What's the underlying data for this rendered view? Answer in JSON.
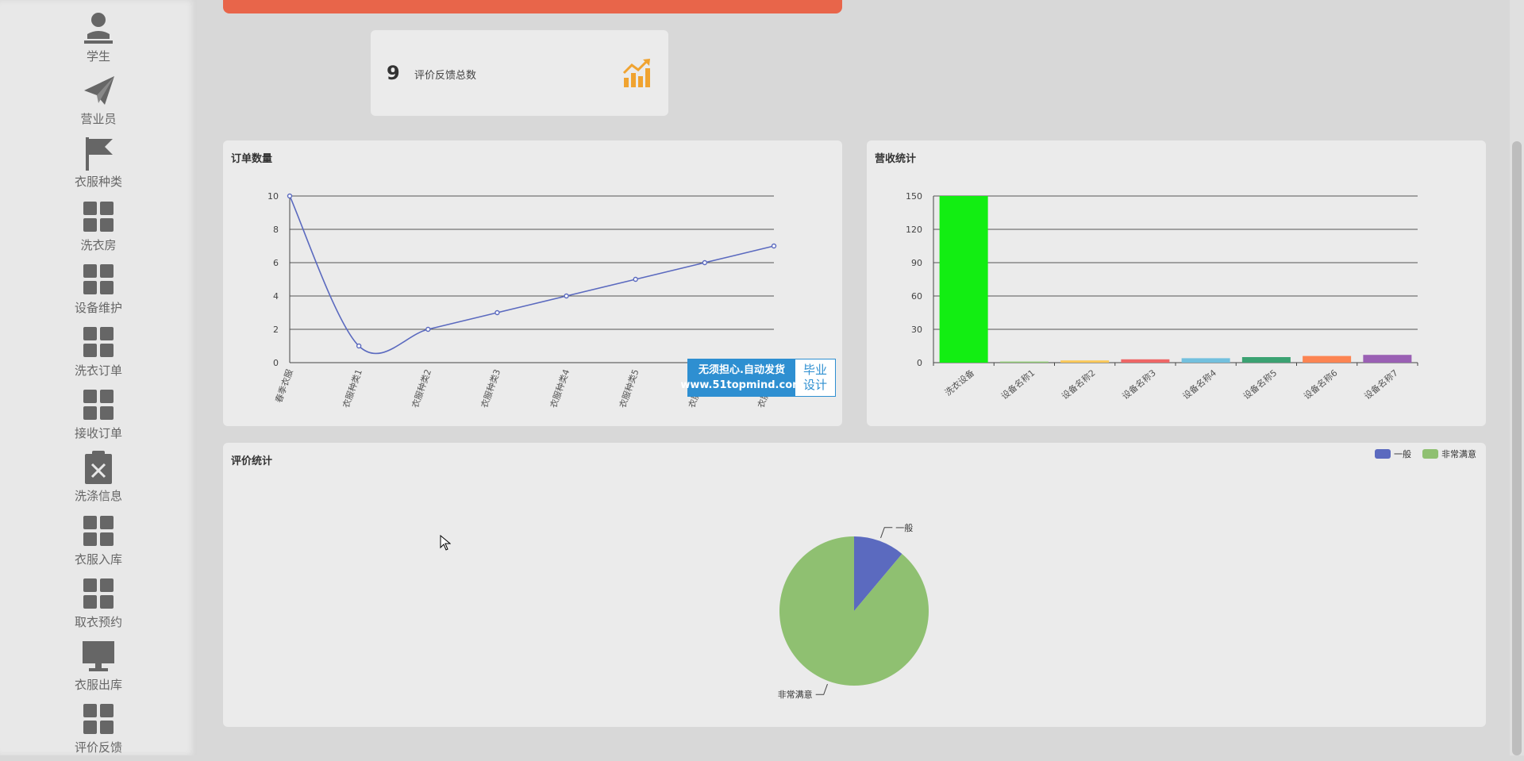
{
  "sidebar": {
    "items": [
      {
        "label": "学生",
        "icon": "user-icon"
      },
      {
        "label": "营业员",
        "icon": "paper-plane-icon"
      },
      {
        "label": "衣服种类",
        "icon": "flag-icon"
      },
      {
        "label": "洗衣房",
        "icon": "grid-icon"
      },
      {
        "label": "设备维护",
        "icon": "grid-icon"
      },
      {
        "label": "洗衣订单",
        "icon": "grid-icon"
      },
      {
        "label": "接收订单",
        "icon": "grid-icon"
      },
      {
        "label": "洗涤信息",
        "icon": "clipboard-x-icon"
      },
      {
        "label": "衣服入库",
        "icon": "grid-icon"
      },
      {
        "label": "取衣预约",
        "icon": "grid-icon"
      },
      {
        "label": "衣服出库",
        "icon": "monitor-icon"
      },
      {
        "label": "评价反馈",
        "icon": "grid-icon"
      }
    ]
  },
  "stat": {
    "value": "9",
    "label": "评价反馈总数",
    "icon": "chart-up-icon"
  },
  "panels": {
    "orders": {
      "title": "订单数量"
    },
    "revenue": {
      "title": "营收统计"
    },
    "ratings": {
      "title": "评价统计"
    }
  },
  "watermark": {
    "line1": "无须担心.自动发货",
    "line2": "www.51topmind.com",
    "side1": "毕业",
    "side2": "设计"
  },
  "chart_data": [
    {
      "type": "line",
      "title": "订单数量",
      "categories": [
        "春季衣服",
        "衣服种类1",
        "衣服种类2",
        "衣服种类3",
        "衣服种类4",
        "衣服种类5",
        "衣服种类6",
        "衣服种类7"
      ],
      "values": [
        10,
        1,
        2,
        3,
        4,
        5,
        6,
        7
      ],
      "ylim": [
        0,
        10
      ],
      "yticks": [
        0,
        2,
        4,
        6,
        8,
        10
      ],
      "color": "#5b6abf",
      "grid": true
    },
    {
      "type": "bar",
      "title": "营收统计",
      "categories": [
        "洗衣设备",
        "设备名称1",
        "设备名称2",
        "设备名称3",
        "设备名称4",
        "设备名称5",
        "设备名称6",
        "设备名称7"
      ],
      "values": [
        150,
        1,
        2,
        3,
        4,
        5,
        6,
        7
      ],
      "colors": [
        "#12ee12",
        "#91cc75",
        "#fac858",
        "#ee6666",
        "#73c0de",
        "#3ba272",
        "#fc8452",
        "#9a60b4"
      ],
      "ylim": [
        0,
        150
      ],
      "yticks": [
        0,
        30,
        60,
        90,
        120,
        150
      ],
      "grid": true
    },
    {
      "type": "pie",
      "title": "评价统计",
      "slices": [
        {
          "name": "一般",
          "value": 1,
          "color": "#5b6abf"
        },
        {
          "name": "非常满意",
          "value": 8,
          "color": "#8fc071"
        }
      ],
      "legend": "top-right"
    }
  ]
}
